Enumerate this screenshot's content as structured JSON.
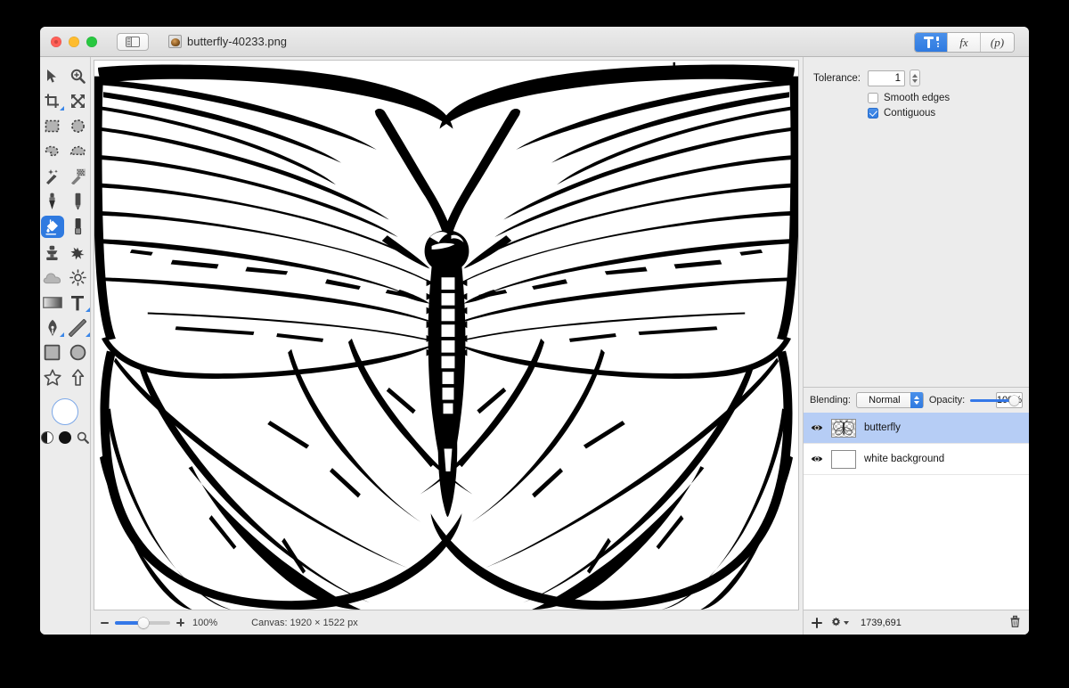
{
  "window": {
    "document_title": "butterfly-40233.png",
    "traffic_lights": [
      "close",
      "minimize",
      "maximize"
    ],
    "sidebar_toggle": "sidebar-toggle"
  },
  "mode_bar": {
    "modes": [
      {
        "id": "tool-options",
        "label": "",
        "icon": "tools-icon",
        "active": true
      },
      {
        "id": "effects",
        "label": "fx",
        "icon": "fx-icon",
        "active": false
      },
      {
        "id": "presets",
        "label": "(p)",
        "icon": "preset-icon",
        "active": false
      }
    ]
  },
  "tool_palette": {
    "tools": [
      {
        "id": "move-select",
        "name": "arrow-select-tool",
        "selected": false,
        "has_submenu": false
      },
      {
        "id": "zoom",
        "name": "zoom-tool",
        "selected": false,
        "has_submenu": false
      },
      {
        "id": "crop",
        "name": "crop-tool",
        "selected": false,
        "has_submenu": true
      },
      {
        "id": "transform",
        "name": "move-transform-tool",
        "selected": false,
        "has_submenu": false
      },
      {
        "id": "rect-select",
        "name": "rectangle-select-tool",
        "selected": false,
        "has_submenu": false
      },
      {
        "id": "ellipse-select",
        "name": "ellipse-select-tool",
        "selected": false,
        "has_submenu": false
      },
      {
        "id": "lasso",
        "name": "lasso-select-tool",
        "selected": false,
        "has_submenu": false
      },
      {
        "id": "polygon-lasso",
        "name": "polygon-lasso-tool",
        "selected": false,
        "has_submenu": false
      },
      {
        "id": "magic-wand",
        "name": "magic-wand-tool",
        "selected": false,
        "has_submenu": false
      },
      {
        "id": "magic-eraser",
        "name": "magic-eraser-tool",
        "selected": false,
        "has_submenu": false
      },
      {
        "id": "paintbrush",
        "name": "paintbrush-tool",
        "selected": false,
        "has_submenu": false
      },
      {
        "id": "pencil",
        "name": "pencil-tool",
        "selected": false,
        "has_submenu": false
      },
      {
        "id": "paint-bucket",
        "name": "paint-bucket-tool",
        "selected": true,
        "has_submenu": false
      },
      {
        "id": "eraser",
        "name": "eraser-tool",
        "selected": false,
        "has_submenu": false
      },
      {
        "id": "clone-stamp",
        "name": "clone-stamp-tool",
        "selected": false,
        "has_submenu": false
      },
      {
        "id": "smudge",
        "name": "smudge-tool",
        "selected": false,
        "has_submenu": false
      },
      {
        "id": "blur",
        "name": "blur-cloud-tool",
        "selected": false,
        "has_submenu": false
      },
      {
        "id": "dodge",
        "name": "dodge-brightness-tool",
        "selected": false,
        "has_submenu": false
      },
      {
        "id": "gradient",
        "name": "gradient-tool",
        "selected": false,
        "has_submenu": false
      },
      {
        "id": "text",
        "name": "text-tool",
        "selected": false,
        "has_submenu": true
      },
      {
        "id": "pen",
        "name": "pen-tool",
        "selected": false,
        "has_submenu": true
      },
      {
        "id": "line",
        "name": "line-tool",
        "selected": false,
        "has_submenu": true
      },
      {
        "id": "rectangle-shape",
        "name": "rectangle-shape-tool",
        "selected": false,
        "has_submenu": false
      },
      {
        "id": "ellipse-shape",
        "name": "ellipse-shape-tool",
        "selected": false,
        "has_submenu": false
      },
      {
        "id": "star-shape",
        "name": "star-shape-tool",
        "selected": false,
        "has_submenu": false
      },
      {
        "id": "arrow-shape",
        "name": "arrow-shape-tool",
        "selected": false,
        "has_submenu": false
      }
    ],
    "color_swatches": {
      "primary_color": "#FFFFFF",
      "secondary_color": "#111111",
      "split_swatch": "split-color-swatch",
      "picker": "color-picker-icon"
    }
  },
  "tool_options": {
    "tolerance_label": "Tolerance:",
    "tolerance_value": "1",
    "smooth_edges_label": "Smooth edges",
    "smooth_edges_checked": false,
    "contiguous_label": "Contiguous",
    "contiguous_checked": true
  },
  "layers_panel": {
    "blending_label": "Blending:",
    "blending_value": "Normal",
    "opacity_label": "Opacity:",
    "opacity_value": "100%",
    "layers": [
      {
        "name": "butterfly",
        "visible": true,
        "selected": true,
        "thumb": "butterfly-thumb"
      },
      {
        "name": "white background",
        "visible": true,
        "selected": false,
        "thumb": "white-thumb"
      }
    ],
    "footer": {
      "add_label": "add-layer",
      "settings_label": "layer-settings",
      "count": "1739,691",
      "delete_label": "delete-layer"
    }
  },
  "status_bar": {
    "zoom_level": "100%",
    "canvas_size": "Canvas: 1920 × 1522 px",
    "zoom_out": "−",
    "zoom_in": "+"
  },
  "canvas": {
    "artwork_name": "butterfly-line-art",
    "background": "#FFFFFF",
    "ink": "#000000"
  },
  "colors": {
    "accent": "#2F7AE0",
    "selection": "#B6CDF5",
    "chrome": "#ECECEC",
    "desktop": "#000000"
  }
}
